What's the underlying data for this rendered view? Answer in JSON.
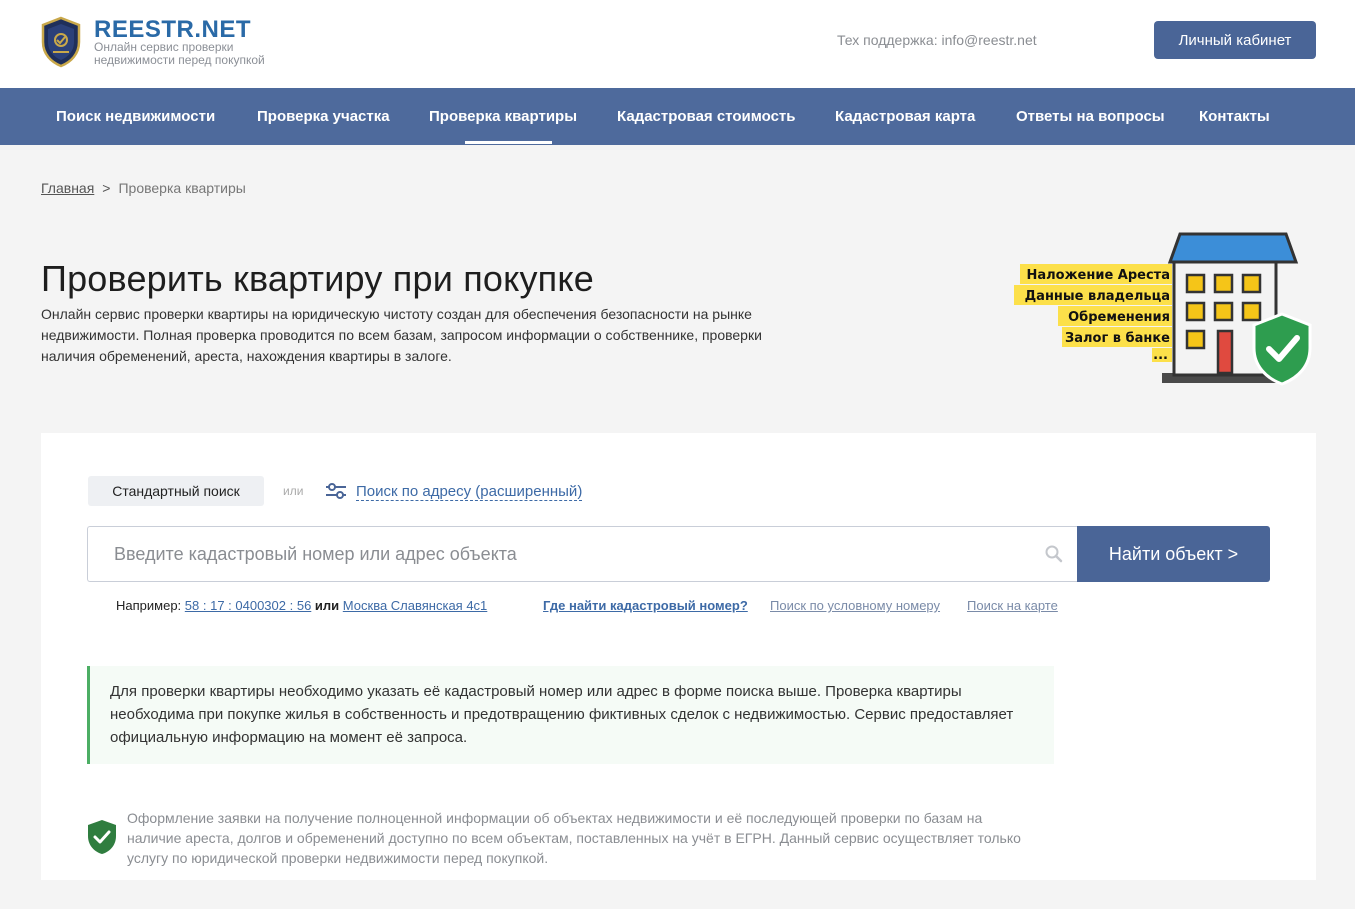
{
  "header": {
    "logo_title": "REESTR.NET",
    "logo_subtitle": "Онлайн сервис проверки недвижимости перед покупкой",
    "support_text": "Тех поддержка: info@reestr.net",
    "cabinet_button": "Личный кабинет"
  },
  "nav": {
    "items": [
      {
        "label": "Поиск недвижимости"
      },
      {
        "label": "Проверка участка"
      },
      {
        "label": "Проверка квартиры"
      },
      {
        "label": "Кадастровая стоимость"
      },
      {
        "label": "Кадастровая карта"
      },
      {
        "label": "Ответы на вопросы"
      },
      {
        "label": "Контакты"
      }
    ],
    "active_index": 2
  },
  "breadcrumb": {
    "home": "Главная",
    "separator": ">",
    "current": "Проверка квартиры"
  },
  "hero": {
    "title": "Проверить квартиру при покупке",
    "intro": "Онлайн сервис проверки квартиры на юридическую чистоту создан для обеспечения безопасности на рынке недвижимости. Полная проверка проводится по всем базам, запросом информации о собственнике, проверки наличия обременений, ареста, нахождения квартиры в залоге.",
    "illustration_labels": [
      "Наложение Ареста",
      "Данные владельца",
      "Обременения",
      "Залог в банке",
      "..."
    ]
  },
  "search": {
    "tab_standard": "Стандартный поиск",
    "or": "или",
    "advanced_link": "Поиск по адресу (расширенный)",
    "placeholder": "Введите кадастровый номер или адрес объекта",
    "button": "Найти объект >",
    "examples_prefix": "Например:",
    "example_cadastral": "58 : 17 : 0400302 : 56",
    "examples_or": "или",
    "example_address": "Москва Славянская 4с1",
    "where_link": "Где найти кадастровый номер?",
    "conditional_link": "Поиск по условному номеру",
    "map_link": "Поиск на карте"
  },
  "info_box": {
    "text": "Для проверки квартиры необходимо указать её кадастровый номер или адрес в форме поиска выше. Проверка квартиры необходима при покупке жилья в собственность и предотвращению фиктивных сделок с недвижимостью. Сервис предоставляет официальную информацию на момент её запроса."
  },
  "note": {
    "text": "Оформление заявки на получение полноценной информации об объектах недвижимости и её последующей проверки по базам на наличие ареста, долгов и обременений доступно по всем объектам, поставленных на учёт в ЕГРН. Данный сервис осуществляет только услугу по юридической проверки недвижимости перед покупкой."
  },
  "colors": {
    "nav_bg": "#4e6a9c",
    "button_bg": "#4a6597",
    "link": "#3d6aa6",
    "accent_green": "#4cae64",
    "brand_blue": "#2a6aa7"
  },
  "icons": [
    "shield-logo-icon",
    "sliders-icon",
    "search-icon",
    "check-shield-icon"
  ]
}
